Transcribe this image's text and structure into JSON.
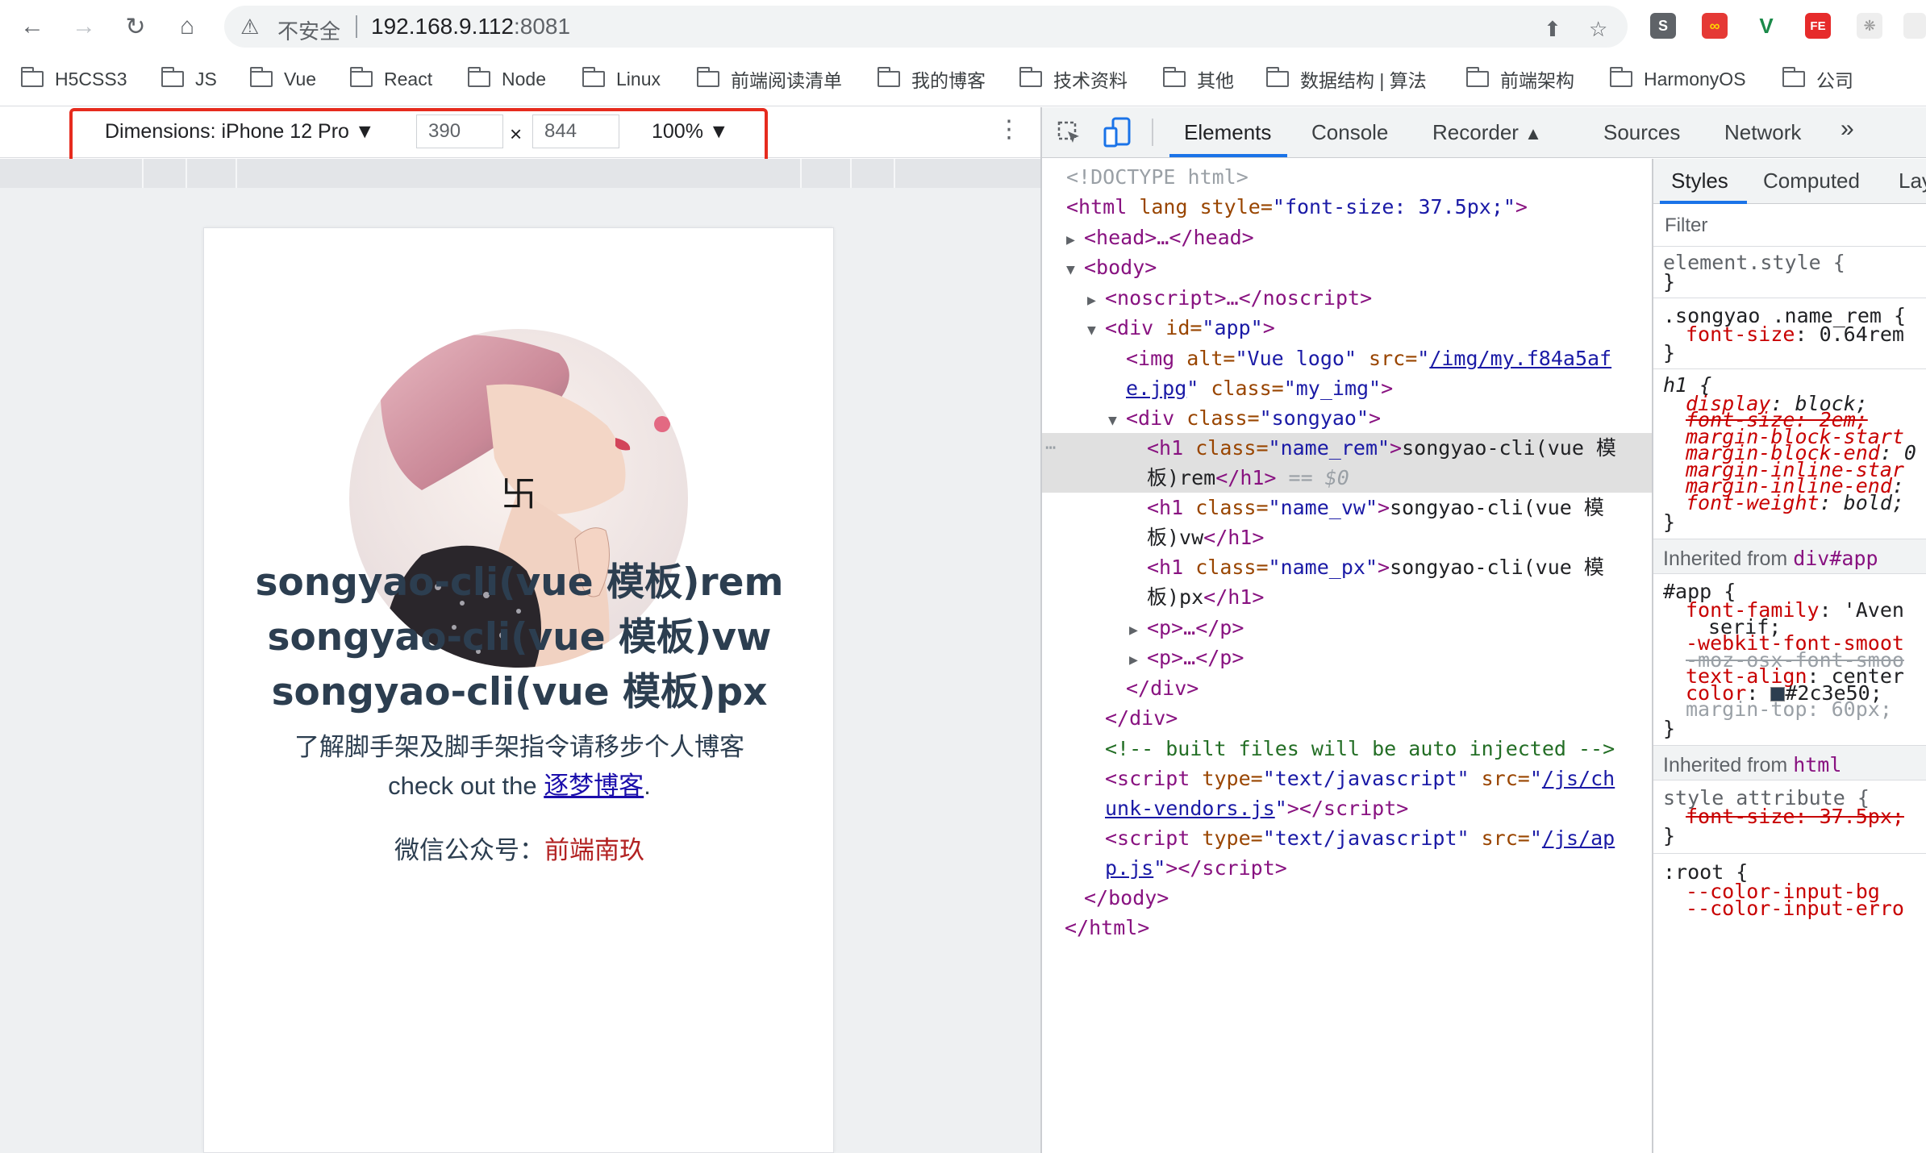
{
  "browser": {
    "insecure_label": "不安全",
    "url_host": "192.168.9.112",
    "url_port": ":8081",
    "extensions": [
      "S",
      "∞",
      "V",
      "FE",
      "❋"
    ]
  },
  "bookmarks": [
    "H5CSS3",
    "JS",
    "Vue",
    "React",
    "Node",
    "Linux",
    "前端阅读清单",
    "我的博客",
    "技术资料",
    "其他",
    "数据结构 | 算法",
    "前端架构",
    "HarmonyOS",
    "公司"
  ],
  "device_toolbar": {
    "dimensions_label": "Dimensions: iPhone 12 Pro",
    "width": "390",
    "times": "×",
    "height": "844",
    "zoom": "100%"
  },
  "page": {
    "h1_rem": "songyao-cli(vue 模板)rem",
    "h1_vw": "songyao-cli(vue 模板)vw",
    "h1_px": "songyao-cli(vue 模板)px",
    "p1_line1": "了解脚手架及脚手架指令请移步个人博客",
    "p1_prefix": "check out the ",
    "p1_link": "逐梦博客",
    "p1_suffix": ".",
    "p2_label": "微信公众号：",
    "p2_value": "前端南玖"
  },
  "devtools": {
    "tabs": [
      "Elements",
      "Console",
      "Recorder",
      "Sources",
      "Network"
    ],
    "more": "»",
    "styles_tabs": [
      "Styles",
      "Computed",
      "Lay"
    ],
    "filter_placeholder": "Filter",
    "dots": "⋯"
  },
  "dom_lines": {
    "doctype": "<!DOCTYPE html>",
    "html_open_tag": "<html",
    "html_attr": " lang style=",
    "html_val": "\"font-size: 37.5px;\"",
    "html_close_bracket": ">",
    "head": "<head>…</head>",
    "body_open": "<body>",
    "noscript": "<noscript>…</noscript>",
    "div_app_tag": "<div ",
    "div_app_attr": "id=",
    "div_app_val": "\"app\"",
    "img_tag": "<img ",
    "img_a1": "alt=",
    "img_v1": "\"Vue logo\"",
    "img_a2": " src=",
    "img_v2a": "\"",
    "img_link1": "/img/my.f84a5af",
    "img_link2": "e.jpg",
    "img_rest_q": "\"",
    "img_a3": " class=",
    "img_v3": "\"my_img\"",
    "div_song_tag": "<div ",
    "div_song_attr": "class=",
    "div_song_val": "\"songyao\"",
    "h1a_text1": "songyao-cli(vue 模",
    "h1a_text2": "板)rem",
    "h1a_cls": "\"name_rem\"",
    "h1b_text1": "songyao-cli(vue 模",
    "h1b_text2": "板)vw",
    "h1b_cls": "\"name_vw\"",
    "h1c_text1": "songyao-cli(vue 模",
    "h1c_text2": "板)px",
    "h1c_cls": "\"name_px\"",
    "eq0": " == $0",
    "p_collapsed": "<p>…</p>",
    "div_close": "</div>",
    "comment": "<!-- built files will be auto injected -->",
    "script1_link1": "/js/ch",
    "script1_link2": "unk-vendors.js",
    "script2_link1": "/js/ap",
    "script2_link2": "p.js",
    "script_type": "\"text/javascript\"",
    "body_close": "</body>",
    "html_close": "</html>"
  },
  "styles": {
    "element_style": "element.style {",
    "close": "}",
    "rule1_sel": ".songyao .name_rem {",
    "rule1_prop": "font-size",
    "rule1_val": ": 0.64rem",
    "h1_sel": "h1 {",
    "h1_props": [
      {
        "n": "display",
        "v": ": block;"
      },
      {
        "n": "font-size: 2em;",
        "v": ""
      },
      {
        "n": "margin-block-start",
        "v": ""
      },
      {
        "n": "margin-block-end",
        "v": ": 0"
      },
      {
        "n": "margin-inline-star",
        "v": ""
      },
      {
        "n": "margin-inline-end",
        "v": ":"
      },
      {
        "n": "font-weight",
        "v": ": bold;"
      }
    ],
    "inh1_label": "Inherited from ",
    "inh1_sel": "div#app",
    "app_sel": "#app {",
    "app_p1n": "font-family",
    "app_p1v": ": 'Aven",
    "app_p1c": "serif;",
    "app_p2n": "-webkit-font-smoot",
    "app_p3": "-moz-osx-font-smoo",
    "app_p4n": "text-align",
    "app_p4v": ": center",
    "app_p5n": "color",
    "app_p5v": "#2c3e50;",
    "color_swatch": "#2c3e50",
    "app_p6n": "margin-top",
    "app_p6v": ": 60px;",
    "inh2_label": "Inherited from ",
    "inh2_sel": "html",
    "sa_sel": "style attribute {",
    "sa_p": "font-size: 37.5px;",
    "root_sel": ":root {",
    "root_p1": "--color-input-bg",
    "root_p2": "--color-input-erro"
  }
}
